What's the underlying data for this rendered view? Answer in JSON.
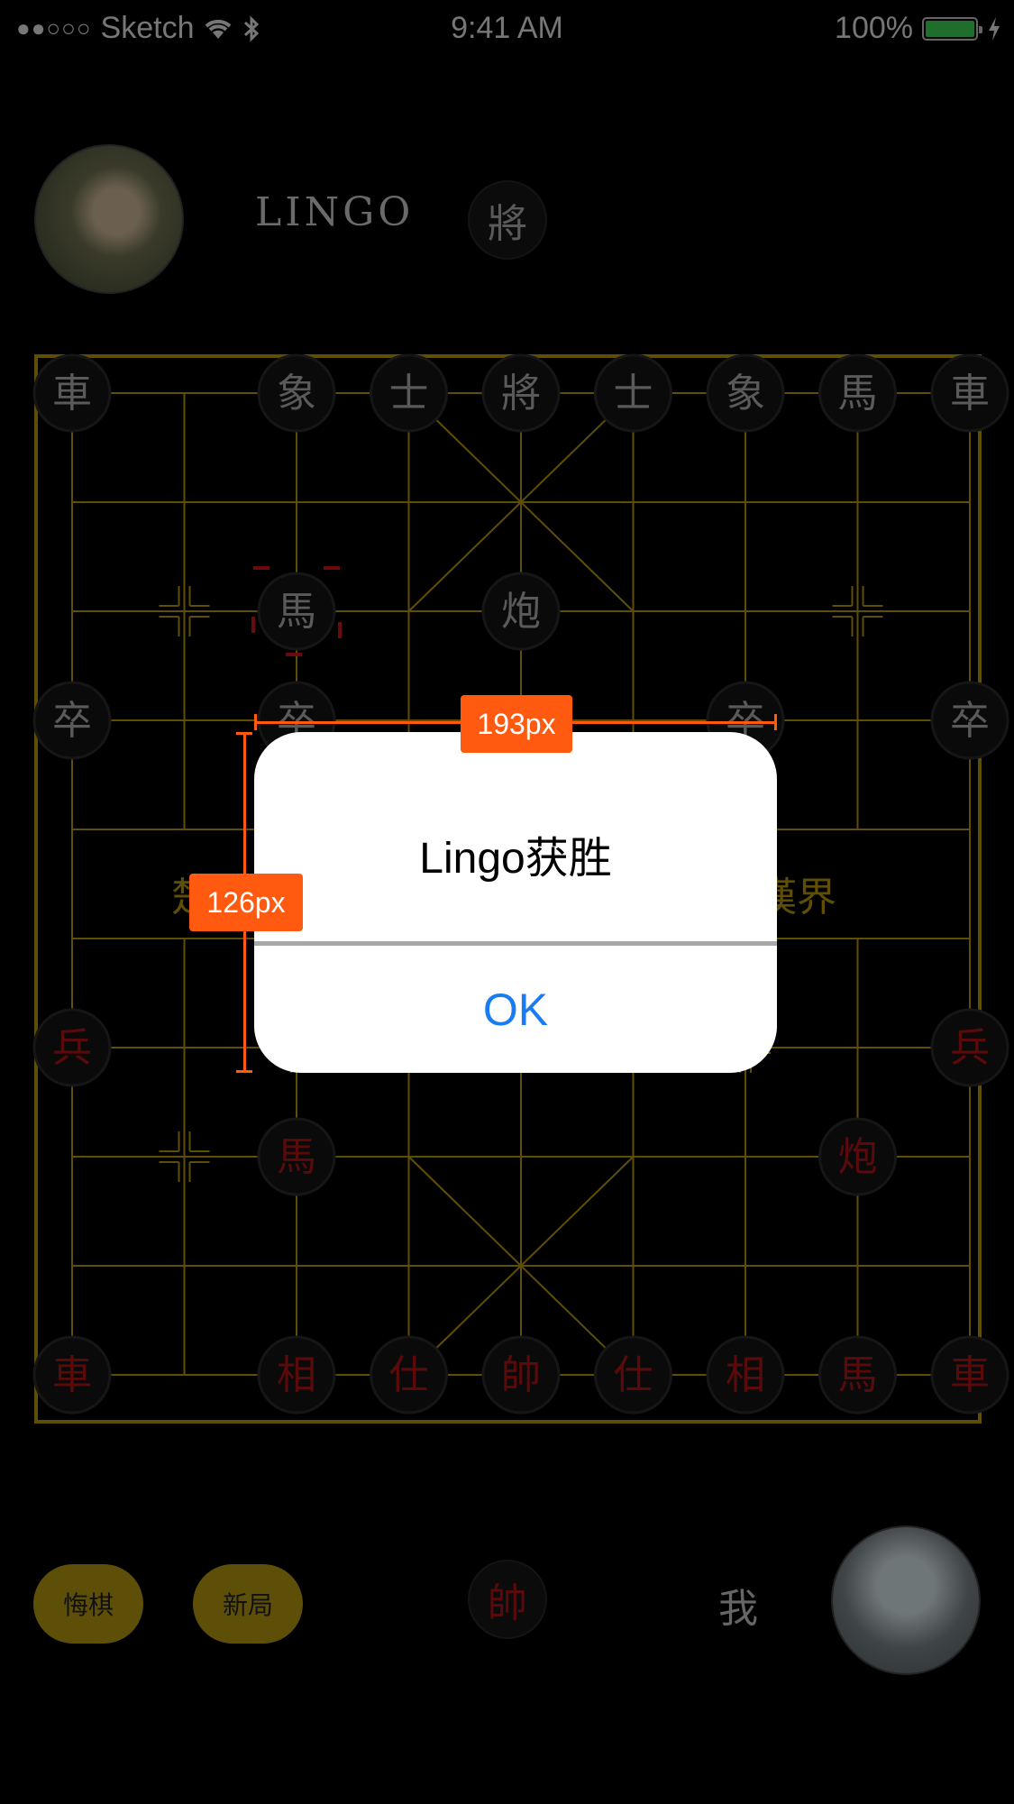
{
  "status_bar": {
    "carrier": "Sketch",
    "signal_dots": "●●○○○",
    "time": "9:41 AM",
    "battery_percent": "100%",
    "battery_level": 1.0
  },
  "opponent": {
    "name": "LINGO",
    "turn_piece": "將"
  },
  "player": {
    "label": "我",
    "turn_piece": "帥"
  },
  "board": {
    "river_left": "楚",
    "river_right": "漢界",
    "black_pieces": [
      {
        "char": "車",
        "col": 0,
        "row": 0
      },
      {
        "char": "象",
        "col": 2,
        "row": 0
      },
      {
        "char": "士",
        "col": 3,
        "row": 0
      },
      {
        "char": "將",
        "col": 4,
        "row": 0
      },
      {
        "char": "士",
        "col": 5,
        "row": 0
      },
      {
        "char": "象",
        "col": 6,
        "row": 0
      },
      {
        "char": "馬",
        "col": 7,
        "row": 0
      },
      {
        "char": "車",
        "col": 8,
        "row": 0
      },
      {
        "char": "馬",
        "col": 2,
        "row": 2,
        "selected": true
      },
      {
        "char": "炮",
        "col": 4,
        "row": 2
      },
      {
        "char": "卒",
        "col": 0,
        "row": 3
      },
      {
        "char": "卒",
        "col": 2,
        "row": 3
      },
      {
        "char": "卒",
        "col": 6,
        "row": 3
      },
      {
        "char": "卒",
        "col": 8,
        "row": 3
      }
    ],
    "red_pieces": [
      {
        "char": "兵",
        "col": 0,
        "row": 6
      },
      {
        "char": "兵",
        "col": 8,
        "row": 6
      },
      {
        "char": "馬",
        "col": 2,
        "row": 7
      },
      {
        "char": "炮",
        "col": 7,
        "row": 7
      },
      {
        "char": "車",
        "col": 0,
        "row": 9
      },
      {
        "char": "相",
        "col": 2,
        "row": 9
      },
      {
        "char": "仕",
        "col": 3,
        "row": 9
      },
      {
        "char": "帥",
        "col": 4,
        "row": 9
      },
      {
        "char": "仕",
        "col": 5,
        "row": 9
      },
      {
        "char": "相",
        "col": 6,
        "row": 9
      },
      {
        "char": "馬",
        "col": 7,
        "row": 9
      },
      {
        "char": "車",
        "col": 8,
        "row": 9
      }
    ],
    "colors": {
      "grid": "#5f4e05",
      "black_text": "#5a5a5a",
      "red_text": "#5a0a0a",
      "selection": "#6a0a0a"
    }
  },
  "buttons": {
    "undo": "悔棋",
    "new_game": "新局"
  },
  "alert": {
    "title": "Lingo获胜",
    "ok": "OK"
  },
  "annotations": {
    "width_label": "193px",
    "height_label": "126px",
    "color": "#ff5a10"
  }
}
